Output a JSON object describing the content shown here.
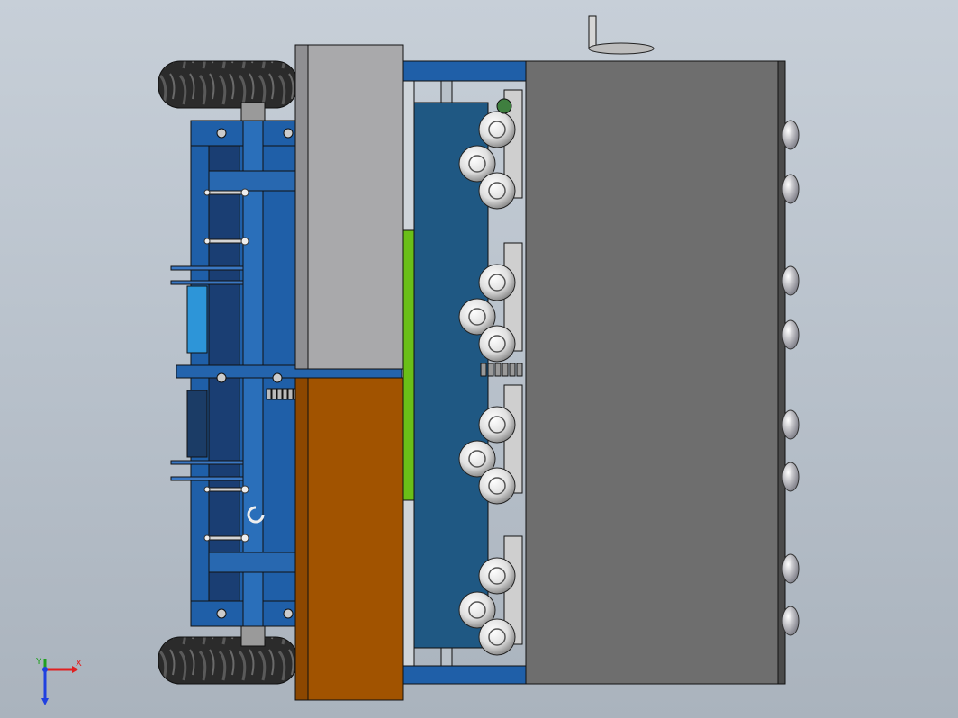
{
  "colors": {
    "background": "#bcc4ce",
    "frame_blue": "#1f5fa8",
    "deep_blue": "#1f5883",
    "light_blue": "#2d95d8",
    "hopper_gray": "#a9a9ab",
    "hopper_orange": "#a15300",
    "belt_green": "#6abf18",
    "cover_gray": "#6e6e6e",
    "tire_dark": "#2b2b2b",
    "roller_light": "#e0e0e0"
  },
  "axes_triad": {
    "x_label": "X",
    "y_label": "Y",
    "x_color": "#e02020",
    "y_color": "#20a020",
    "z_color": "#2040e0"
  }
}
